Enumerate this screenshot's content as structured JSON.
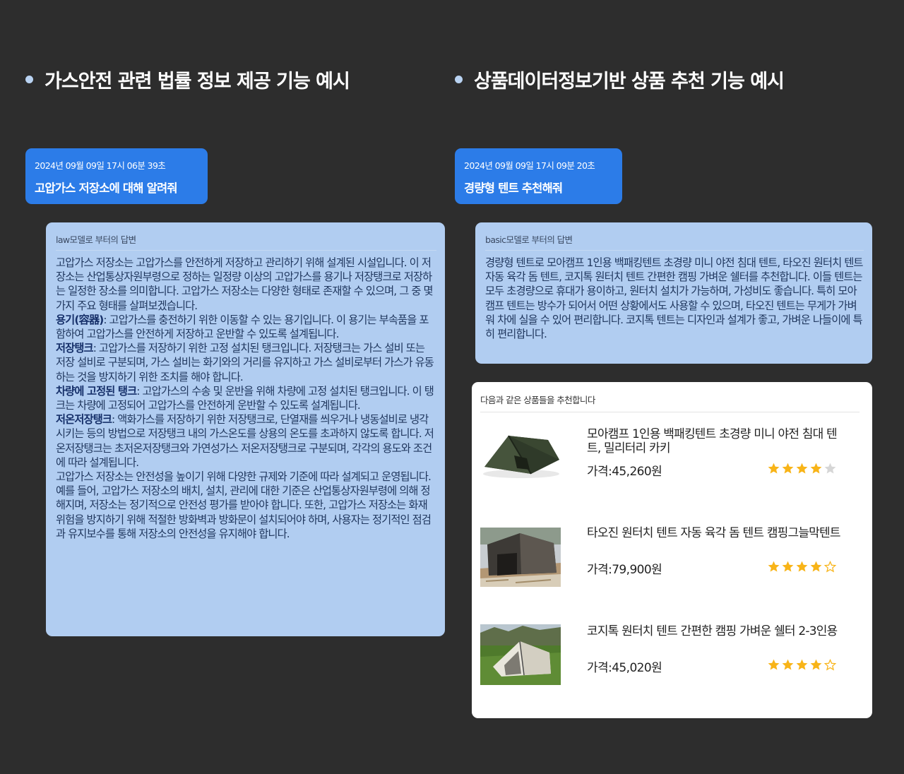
{
  "left_section": {
    "heading": "가스안전 관련 법률 정보 제공 기능 예시",
    "user_message": {
      "timestamp": "2024년 09월 09일 17시 06분 39초",
      "text": "고압가스 저장소에 대해 알려줘"
    },
    "answer": {
      "source_label": "law모델로 부터의 답변",
      "intro": "고압가스 저장소는 고압가스를 안전하게 저장하고 관리하기 위해 설계된 시설입니다. 이 저장소는 산업통상자원부령으로 정하는 일정량 이상의 고압가스를 용기나 저장탱크로 저장하는 일정한 장소를 의미합니다. 고압가스 저장소는 다양한 형태로 존재할 수 있으며, 그 중 몇 가지 주요 형태를 살펴보겠습니다.",
      "items": [
        {
          "term": "용기(容器)",
          "desc": ": 고압가스를 충전하기 위한 이동할 수 있는 용기입니다. 이 용기는 부속품을 포함하여 고압가스를 안전하게 저장하고 운반할 수 있도록 설계됩니다."
        },
        {
          "term": "저장탱크",
          "desc": ": 고압가스를 저장하기 위한 고정 설치된 탱크입니다. 저장탱크는 가스 설비 또는 저장 설비로 구분되며, 가스 설비는 화기와의 거리를 유지하고 가스 설비로부터 가스가 유동하는 것을 방지하기 위한 조치를 해야 합니다."
        },
        {
          "term": "차량에 고정된 탱크",
          "desc": ": 고압가스의 수송 및 운반을 위해 차량에 고정 설치된 탱크입니다. 이 탱크는 차량에 고정되어 고압가스를 안전하게 운반할 수 있도록 설계됩니다."
        },
        {
          "term": "저온저장탱크",
          "desc": ": 액화가스를 저장하기 위한 저장탱크로, 단열재를 씌우거나 냉동설비로 냉각시키는 등의 방법으로 저장탱크 내의 가스온도를 상용의 온도를 초과하지 않도록 합니다. 저온저장탱크는 초저온저장탱크와 가연성가스 저온저장탱크로 구분되며, 각각의 용도와 조건에 따라 설계됩니다."
        }
      ],
      "outro": "고압가스 저장소는 안전성을 높이기 위해 다양한 규제와 기준에 따라 설계되고 운영됩니다. 예를 들어, 고압가스 저장소의 배치, 설치, 관리에 대한 기준은 산업통상자원부령에 의해 정해지며, 저장소는 정기적으로 안전성 평가를 받아야 합니다. 또한, 고압가스 저장소는 화재 위험을 방지하기 위해 적절한 방화벽과 방화문이 설치되어야 하며, 사용자는 정기적인 점검과 유지보수를 통해 저장소의 안전성을 유지해야 합니다."
    }
  },
  "right_section": {
    "heading": "상품데이터정보기반 상품 추천 기능 예시",
    "user_message": {
      "timestamp": "2024년 09월 09일 17시 09분 20초",
      "text": "경량형 텐트 추천해줘"
    },
    "answer": {
      "source_label": "basic모델로 부터의 답변",
      "text": "경량형 텐트로 모아캠프 1인용 백패킹텐트 초경량 미니 야전 침대 텐트, 타오진 원터치 텐트 자동 육각 돔 텐트, 코지톡 원터치 텐트 간편한 캠핑 가벼운 쉘터를 추천합니다. 이들 텐트는 모두 초경량으로 휴대가 용이하고, 원터치 설치가 가능하며, 가성비도 좋습니다. 특히 모아캠프 텐트는 방수가 되어서 어떤 상황에서도 사용할 수 있으며, 타오진 텐트는 무게가 가벼워 차에 실을 수 있어 편리합니다. 코지톡 텐트는 디자인과 설계가 좋고, 가벼운 나들이에 특히 편리합니다."
    },
    "recommendations": {
      "header": "다음과 같은 상품들을 추천합니다",
      "products": [
        {
          "name": "모아캠프 1인용 백패킹텐트 초경량 미니 야전 침대 텐트, 밀리터리 카키",
          "price": "가격:45,260원",
          "rating": 4,
          "star_style": "gray-empty"
        },
        {
          "name": "타오진 원터치 텐트 자동 육각 돔 텐트 캠핑그늘막텐트",
          "price": "가격:79,900원",
          "rating": 4,
          "star_style": "outline-empty"
        },
        {
          "name": "코지톡 원터치 텐트 간편한 캠핑 가벼운 쉘터 2-3인용",
          "price": "가격:45,020원",
          "rating": 4,
          "star_style": "outline-empty"
        }
      ]
    }
  },
  "colors": {
    "background": "#2d2d2d",
    "user_bubble": "#2c7ce8",
    "answer_bubble": "#b1cdf1",
    "star_filled": "#f8b418",
    "star_empty_gray": "#d6d6d6"
  }
}
